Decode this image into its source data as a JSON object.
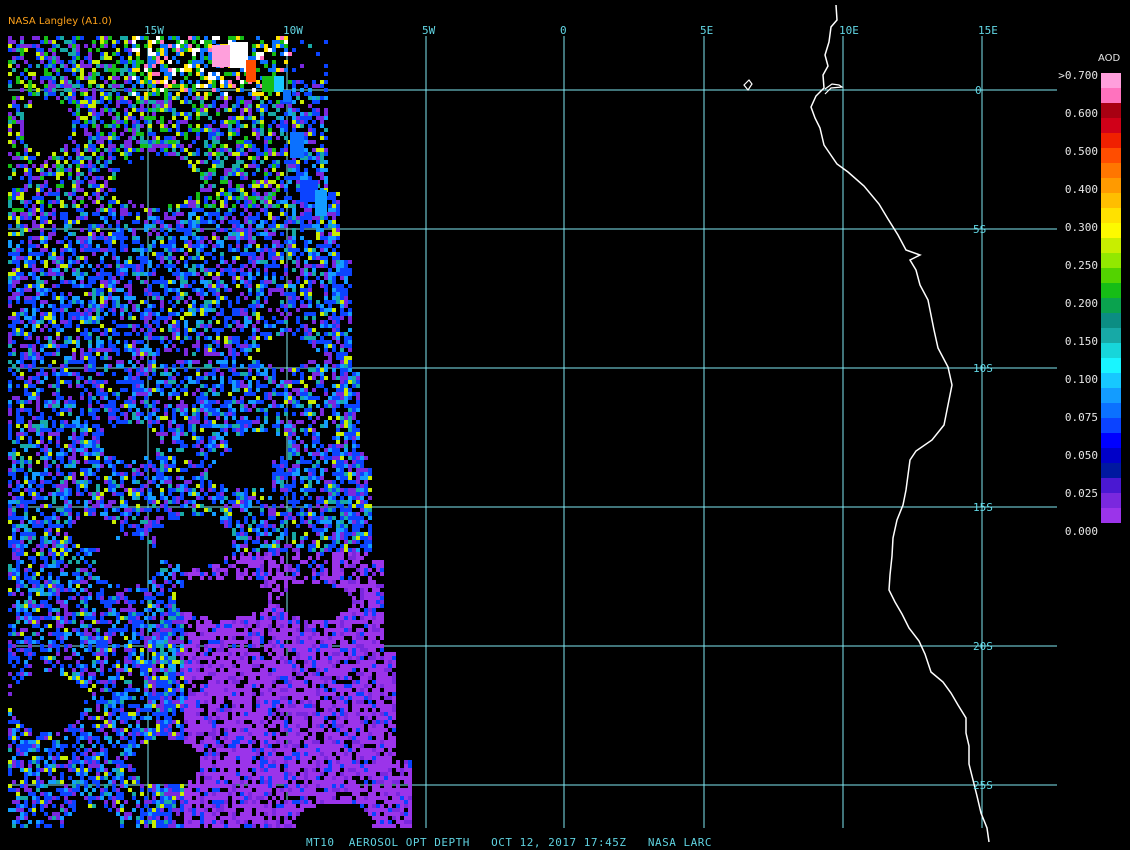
{
  "producer_label": "NASA Langley (A1.0)",
  "footer_label": "MT10  AEROSOL OPT DEPTH   OCT 12, 2017 17:45Z   NASA LARC",
  "legend": {
    "title": "AOD",
    "labels": [
      ">0.700",
      "0.600",
      "0.500",
      "0.400",
      "0.300",
      "0.250",
      "0.200",
      "0.150",
      "0.100",
      "0.075",
      "0.050",
      "0.025",
      "0.000"
    ],
    "colors": [
      "#ff9fdc",
      "#ff72be",
      "#a80012",
      "#d00018",
      "#f02000",
      "#ff4d00",
      "#ff7600",
      "#ff9a00",
      "#ffbe00",
      "#ffe100",
      "#fdfa00",
      "#c8ee00",
      "#92e800",
      "#53d300",
      "#16bd16",
      "#0aa24e",
      "#0b8d83",
      "#17a9a6",
      "#17d6da",
      "#19f5ff",
      "#17c8ff",
      "#139cff",
      "#0b71ff",
      "#0b43ff",
      "#0000ff",
      "#0000c8",
      "#0018a0",
      "#4a18d2",
      "#7a28de",
      "#9b34ea"
    ]
  },
  "map": {
    "lon_labels": [
      "15W",
      "10W",
      "5W",
      "0",
      "5E",
      "10E",
      "15E"
    ],
    "lat_labels": [
      "0",
      "5S",
      "10S",
      "15S",
      "20S",
      "25S"
    ],
    "gridline_color": "#7fe7f2",
    "coastline_color": "#ffffff",
    "background_color": "#000000"
  }
}
